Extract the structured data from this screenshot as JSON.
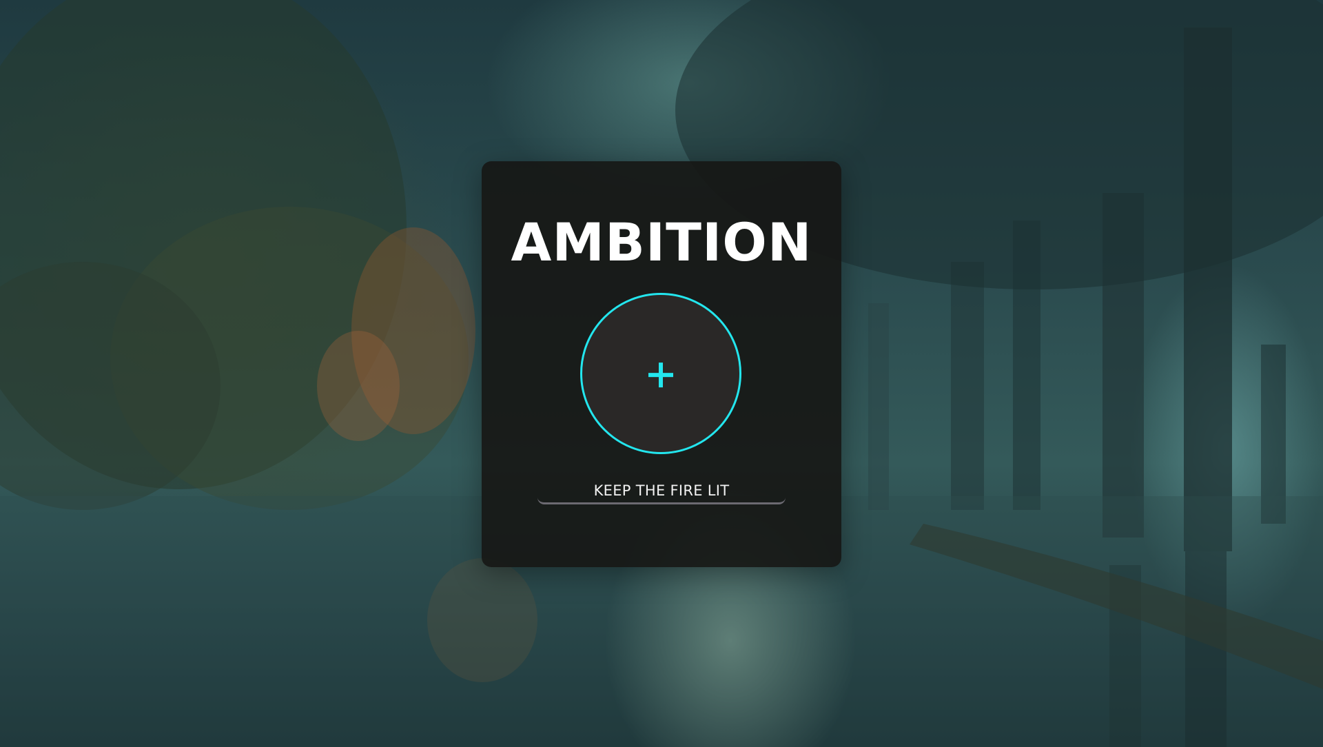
{
  "card": {
    "title": "AMBITION",
    "add_button_icon": "plus-icon",
    "action_label": "KEEP THE FIRE LIT"
  },
  "colors": {
    "accent": "#23e6ee",
    "card_background": "#161614",
    "title_text": "#ffffff"
  }
}
